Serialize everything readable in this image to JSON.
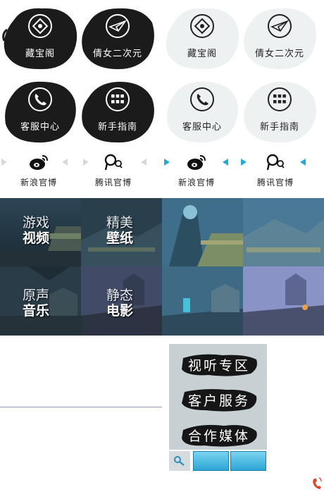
{
  "top_icons": {
    "dark": [
      {
        "label": "藏宝阁",
        "icon": "treasure-compass-icon"
      },
      {
        "label": "倩女二次元",
        "icon": "paper-plane-icon"
      },
      {
        "label": "客服中心",
        "icon": "phone-icon"
      },
      {
        "label": "新手指南",
        "icon": "grid-icon"
      }
    ],
    "light": [
      {
        "label": "藏宝阁",
        "icon": "treasure-compass-icon"
      },
      {
        "label": "倩女二次元",
        "icon": "paper-plane-icon"
      },
      {
        "label": "客服中心",
        "icon": "phone-icon"
      },
      {
        "label": "新手指南",
        "icon": "grid-icon"
      }
    ]
  },
  "social": [
    {
      "label": "新浪官博",
      "icon": "weibo-icon"
    },
    {
      "label": "腾讯官博",
      "icon": "tencent-weibo-icon"
    },
    {
      "label": "新浪官博",
      "icon": "weibo-icon"
    },
    {
      "label": "腾讯官博",
      "icon": "tencent-weibo-icon"
    }
  ],
  "media_tiles": [
    {
      "line1": "游戏",
      "line2": "视频"
    },
    {
      "line1": "精美",
      "line2": "壁纸"
    },
    {
      "line1": "原声",
      "line2": "音乐"
    },
    {
      "line1": "静态",
      "line2": "电影"
    }
  ],
  "menu": {
    "items": [
      "视听专区",
      "客户服务",
      "合作媒体"
    ]
  },
  "colors": {
    "accent_blue": "#24a8d8",
    "ink_dark": "#1b1b1b",
    "ink_light": "#eef1f2",
    "menu_bg": "#c7d1d3"
  }
}
